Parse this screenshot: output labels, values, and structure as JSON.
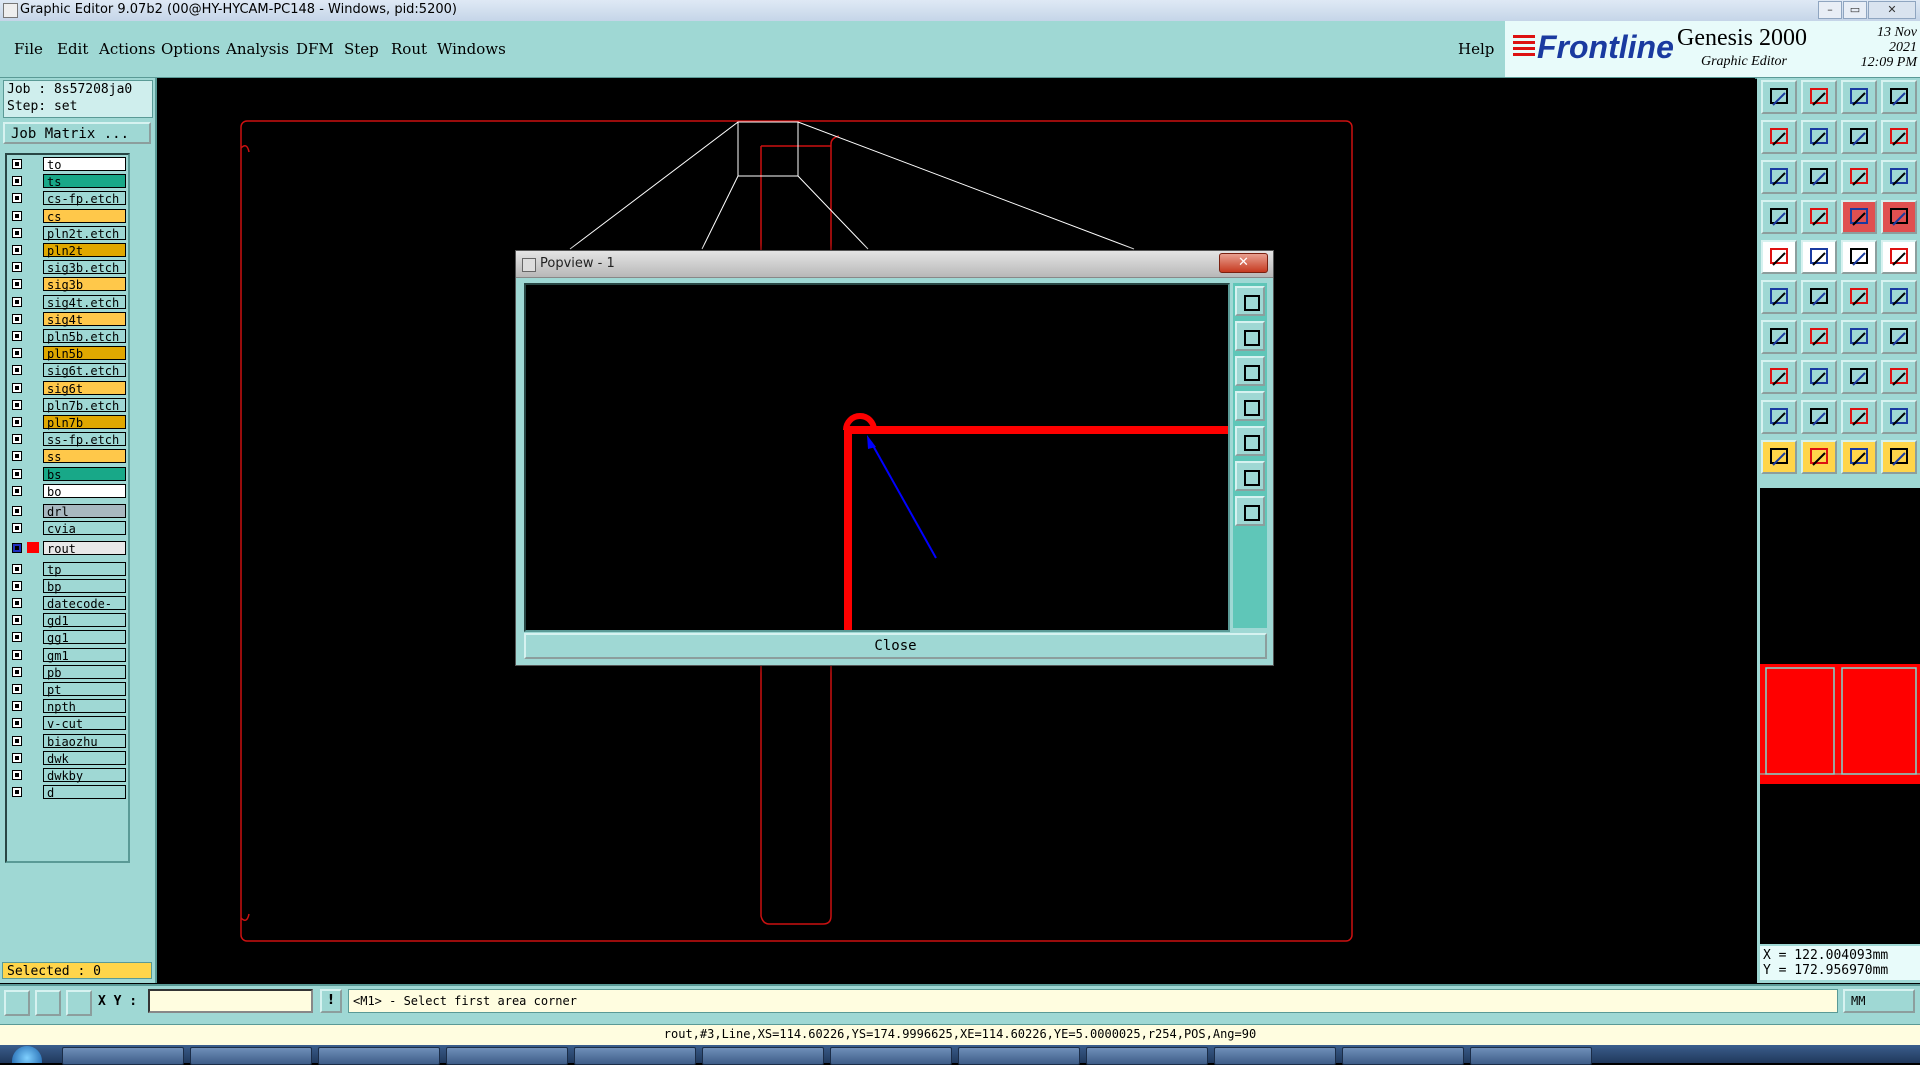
{
  "window": {
    "title": "Graphic Editor 9.07b2 (00@HY-HYCAM-PC148 - Windows, pid:5200)"
  },
  "menu": {
    "items": [
      "File",
      "Edit",
      "Actions",
      "Options",
      "Analysis",
      "DFM",
      "Step",
      "Rout",
      "Windows"
    ],
    "help": "Help"
  },
  "brand": {
    "logo": "Frontline",
    "product": "Genesis 2000",
    "subtitle": "Graphic Editor",
    "date": "13 Nov 2021",
    "time": "12:09 PM"
  },
  "job": {
    "job_line": "Job : 8s57208ja0",
    "step_line": "Step: set",
    "matrix_button": "Job Matrix ..."
  },
  "layers": [
    {
      "name": "to",
      "color": "#ffffff"
    },
    {
      "name": "ts",
      "color": "#18a888"
    },
    {
      "name": "cs-fp.etch",
      "color": "#9fd8d4"
    },
    {
      "name": "cs",
      "color": "#ffc84a"
    },
    {
      "name": "pln2t.etch",
      "color": "#9fd8d4"
    },
    {
      "name": "pln2t",
      "color": "#e0a800"
    },
    {
      "name": "sig3b.etch",
      "color": "#9fd8d4"
    },
    {
      "name": "sig3b",
      "color": "#ffc84a"
    },
    {
      "name": "sig4t.etch",
      "color": "#9fd8d4"
    },
    {
      "name": "sig4t",
      "color": "#ffc84a"
    },
    {
      "name": "pln5b.etch",
      "color": "#9fd8d4"
    },
    {
      "name": "pln5b",
      "color": "#e0a800"
    },
    {
      "name": "sig6t.etch",
      "color": "#9fd8d4"
    },
    {
      "name": "sig6t",
      "color": "#ffc84a"
    },
    {
      "name": "pln7b.etch",
      "color": "#9fd8d4"
    },
    {
      "name": "pln7b",
      "color": "#e0a800"
    },
    {
      "name": "ss-fp.etch",
      "color": "#9fd8d4"
    },
    {
      "name": "ss",
      "color": "#ffc84a"
    },
    {
      "name": "bs",
      "color": "#18a888"
    },
    {
      "name": "bo",
      "color": "#ffffff"
    },
    {
      "name": "drl",
      "color": "#a8b8c0"
    },
    {
      "name": "cvia",
      "color": "#9fd8d4"
    },
    {
      "name": "rout",
      "color": "#e8e8e8",
      "active": true
    },
    {
      "name": "tp",
      "color": "#9fd8d4"
    },
    {
      "name": "bp",
      "color": "#9fd8d4"
    },
    {
      "name": "datecode-to",
      "color": "#9fd8d4"
    },
    {
      "name": "gd1",
      "color": "#9fd8d4"
    },
    {
      "name": "gg1",
      "color": "#9fd8d4"
    },
    {
      "name": "gm1",
      "color": "#9fd8d4"
    },
    {
      "name": "pb",
      "color": "#9fd8d4"
    },
    {
      "name": "pt",
      "color": "#9fd8d4"
    },
    {
      "name": "npth",
      "color": "#9fd8d4"
    },
    {
      "name": "v-cut",
      "color": "#9fd8d4"
    },
    {
      "name": "biaozhu",
      "color": "#9fd8d4"
    },
    {
      "name": "dwk",
      "color": "#9fd8d4"
    },
    {
      "name": "dwkby",
      "color": "#9fd8d4"
    },
    {
      "name": "d",
      "color": "#9fd8d4"
    }
  ],
  "selected_text": "Selected : 0",
  "popup": {
    "title": "Popview - 1",
    "close_label": "Close"
  },
  "coordinates": {
    "x": "X = 122.004093mm",
    "y": "Y = 172.956970mm"
  },
  "bottom": {
    "xy_label": "X Y :",
    "xy_value": "",
    "info_button": "!",
    "prompt": "<M1> - Select first area corner",
    "unit": "MM",
    "status": "rout,#3,Line,XS=114.60226,YS=174.9996625,XE=114.60226,YE=5.0000025,r254,POS,Ang=90"
  },
  "colors": {
    "panel": "#9fd8d4",
    "rout": "#ff0000",
    "outline": "#cc1111",
    "highlight": "#ffd54a"
  }
}
